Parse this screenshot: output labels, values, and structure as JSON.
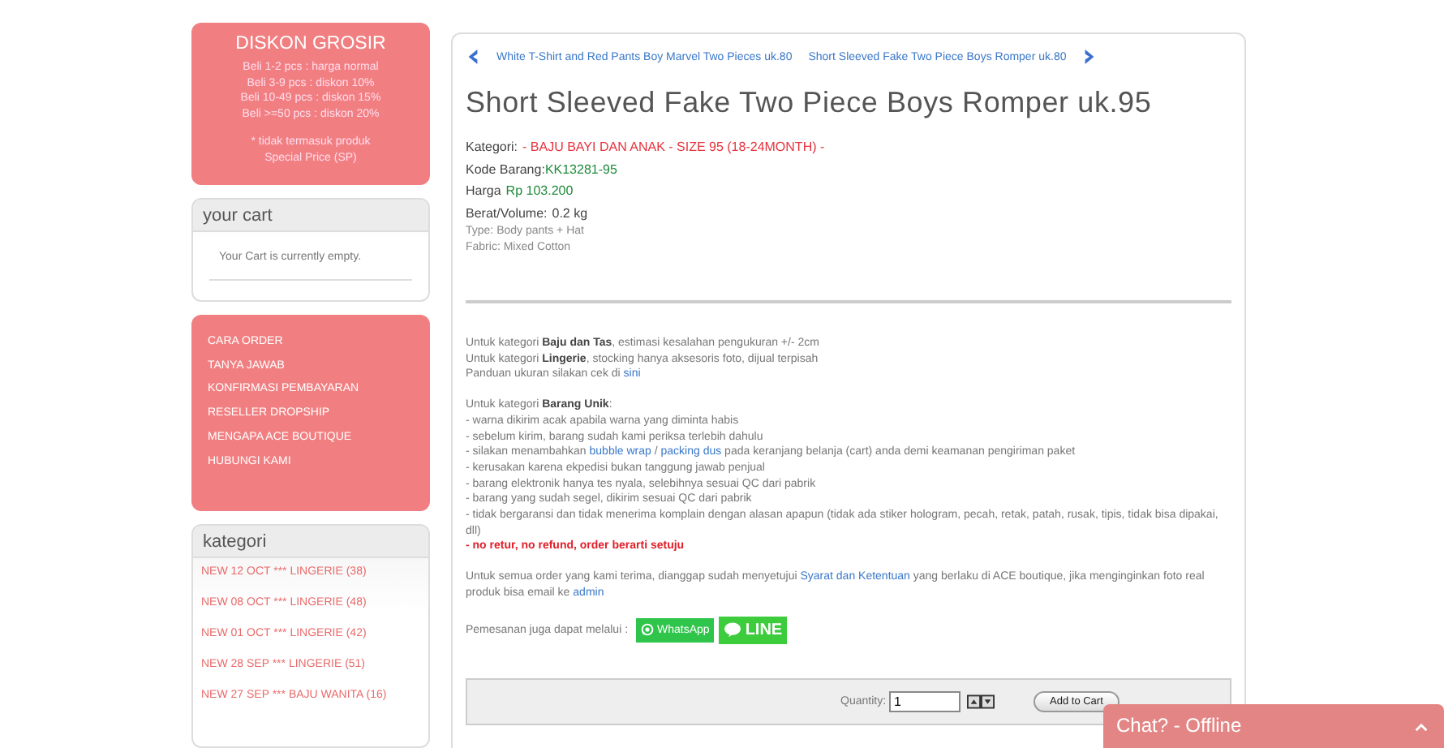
{
  "discount_box": {
    "title": "DISKON GROSIR",
    "lines": [
      "Beli 1-2 pcs : harga normal",
      "Beli 3-9 pcs : diskon 10%",
      "Beli 10-49 pcs : diskon 15%",
      "Beli >=50 pcs : diskon 20%"
    ],
    "note": "* tidak termasuk produk Special Price (SP)"
  },
  "cart": {
    "title": "your cart",
    "message": "Your Cart is currently empty."
  },
  "menu": [
    "CARA ORDER",
    "TANYA JAWAB",
    "KONFIRMASI PEMBAYARAN",
    "RESELLER DROPSHIP",
    "MENGAPA ACE BOUTIQUE",
    "HUBUNGI KAMI"
  ],
  "categories": {
    "title": "kategori",
    "items": [
      "NEW 12 OCT *** LINGERIE (38)",
      "NEW 08 OCT *** LINGERIE (48)",
      "NEW 01 OCT *** LINGERIE (42)",
      "NEW 28 SEP *** LINGERIE (51)",
      "NEW 27 SEP *** BAJU WANITA (16)"
    ]
  },
  "product_nav": {
    "previous": "White T-Shirt and Red Pants Boy Marvel Two Pieces uk.80",
    "next": "Short Sleeved Fake Two Piece Boys Romper uk.80"
  },
  "product": {
    "title": "Short Sleeved Fake Two Piece Boys Romper uk.95",
    "facts": [
      {
        "kind": "category",
        "label": "Kategori:",
        "value": "- BAJU BAYI DAN ANAK - SIZE 95 (18-24MONTH) -"
      },
      {
        "kind": "code",
        "label": "Kode Barang:",
        "value": "KK13281-95"
      },
      {
        "kind": "price",
        "label": "Harga",
        "value": "Rp 103.200"
      },
      {
        "kind": "plain",
        "label": "Berat/Volume:",
        "value": "0.2 kg"
      }
    ],
    "details": [
      "Type: Body pants + Hat",
      "Fabric: Mixed Cotton"
    ]
  },
  "description": [
    [
      [
        {
          "kind": "text",
          "text": "Untuk kategori **Baju dan Tas**, estimasi kesalahan pengukuran +/- 2cm"
        }
      ],
      [
        {
          "kind": "text",
          "text": "Untuk kategori **Lingerie**, stocking hanya aksesoris foto, dijual terpisah"
        }
      ],
      [
        {
          "kind": "text",
          "text": "Panduan ukuran silakan cek di "
        },
        {
          "kind": "link",
          "text": "sini"
        }
      ]
    ],
    [
      [
        {
          "kind": "text",
          "text": "Untuk kategori **Barang Unik**:"
        }
      ],
      [
        {
          "kind": "text",
          "text": "- warna dikirim acak apabila warna yang diminta habis"
        }
      ],
      [
        {
          "kind": "text",
          "text": "- sebelum kirim, barang sudah kami periksa terlebih dahulu"
        }
      ],
      [
        {
          "kind": "text",
          "text": "- silakan menambahkan "
        },
        {
          "kind": "link",
          "text": "bubble wrap"
        },
        {
          "kind": "text",
          "text": " / "
        },
        {
          "kind": "link",
          "text": "packing dus"
        },
        {
          "kind": "text",
          "text": " pada keranjang belanja (cart) anda demi keamanan pengiriman paket"
        }
      ],
      [
        {
          "kind": "text",
          "text": "- kerusakan karena ekpedisi bukan tanggung jawab penjual"
        }
      ],
      [
        {
          "kind": "text",
          "text": "- barang elektronik hanya tes nyala, selebihnya sesuai QC dari pabrik"
        }
      ],
      [
        {
          "kind": "text",
          "text": "- barang yang sudah segel, dikirim sesuai QC dari pabrik"
        }
      ],
      [
        {
          "kind": "text",
          "text": "- tidak bergaransi dan tidak menerima komplain dengan alasan apapun (tidak ada stiker hologram, pecah, retak, patah, rusak, tipis, tidak bisa dipakai, dll)"
        }
      ],
      [
        {
          "kind": "warning",
          "text": "- no retur, no refund, order berarti setuju"
        }
      ]
    ],
    [
      [
        {
          "kind": "text",
          "text": "Untuk semua order yang kami terima, dianggap sudah menyetujui "
        },
        {
          "kind": "link",
          "text": "Syarat dan Ketentuan"
        },
        {
          "kind": "text",
          "text": " yang berlaku di ACE boutique, jika menginginkan foto real produk bisa email ke "
        },
        {
          "kind": "link",
          "text": "admin"
        }
      ]
    ]
  ],
  "order_via": {
    "label": "Pemesanan juga dapat melalui :",
    "buttons": [
      {
        "kind": "whatsapp",
        "label": "WhatsApp"
      },
      {
        "kind": "line",
        "label": "LINE"
      }
    ]
  },
  "purchase": {
    "quantity_label": "Quantity:",
    "quantity": "1",
    "button": "Add to Cart"
  },
  "chat": {
    "label": "Chat? - Offline"
  }
}
